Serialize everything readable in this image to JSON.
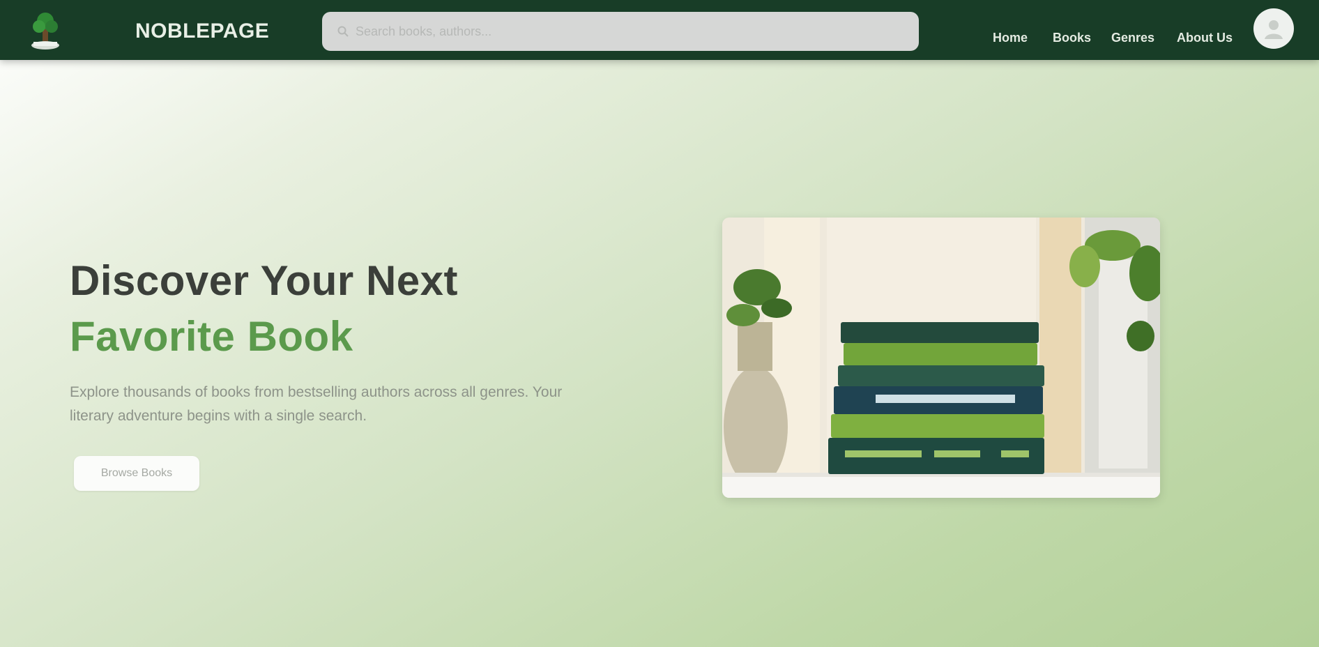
{
  "header": {
    "brand": "NOBLEPAGE",
    "search_placeholder": "Search books, authors...",
    "nav": [
      {
        "label": "Home"
      },
      {
        "label": "Books"
      },
      {
        "label": "Genres"
      },
      {
        "label": "About Us"
      }
    ],
    "icons": {
      "logo": "tree-logo-icon",
      "search": "search-icon",
      "avatar": "user-avatar-icon"
    }
  },
  "hero": {
    "title_line1": "Discover Your Next",
    "title_line2": "Favorite Book",
    "description": "Explore thousands of books from bestselling authors across all genres. Your literary adventure begins with a single search.",
    "cta_label": "Browse Books",
    "image": "stacked-books-photo"
  },
  "colors": {
    "header_bg": "#183d27",
    "accent_green": "#5b9a4c",
    "title_dark": "#3b3f3a"
  }
}
